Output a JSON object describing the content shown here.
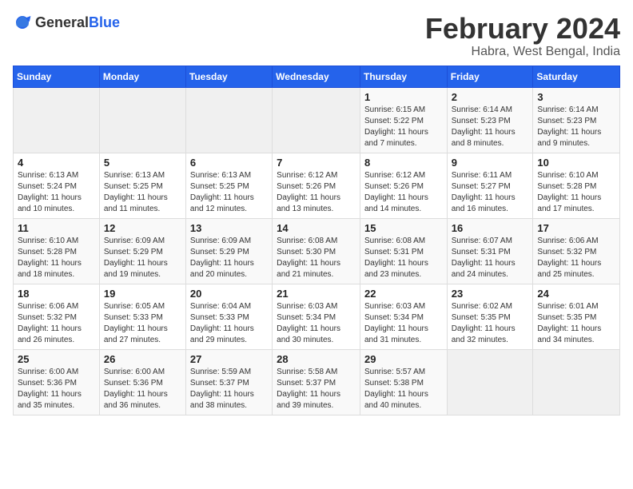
{
  "logo": {
    "general": "General",
    "blue": "Blue"
  },
  "title": {
    "month": "February 2024",
    "location": "Habra, West Bengal, India"
  },
  "headers": [
    "Sunday",
    "Monday",
    "Tuesday",
    "Wednesday",
    "Thursday",
    "Friday",
    "Saturday"
  ],
  "weeks": [
    [
      {
        "day": "",
        "info": ""
      },
      {
        "day": "",
        "info": ""
      },
      {
        "day": "",
        "info": ""
      },
      {
        "day": "",
        "info": ""
      },
      {
        "day": "1",
        "info": "Sunrise: 6:15 AM\nSunset: 5:22 PM\nDaylight: 11 hours\nand 7 minutes."
      },
      {
        "day": "2",
        "info": "Sunrise: 6:14 AM\nSunset: 5:23 PM\nDaylight: 11 hours\nand 8 minutes."
      },
      {
        "day": "3",
        "info": "Sunrise: 6:14 AM\nSunset: 5:23 PM\nDaylight: 11 hours\nand 9 minutes."
      }
    ],
    [
      {
        "day": "4",
        "info": "Sunrise: 6:13 AM\nSunset: 5:24 PM\nDaylight: 11 hours\nand 10 minutes."
      },
      {
        "day": "5",
        "info": "Sunrise: 6:13 AM\nSunset: 5:25 PM\nDaylight: 11 hours\nand 11 minutes."
      },
      {
        "day": "6",
        "info": "Sunrise: 6:13 AM\nSunset: 5:25 PM\nDaylight: 11 hours\nand 12 minutes."
      },
      {
        "day": "7",
        "info": "Sunrise: 6:12 AM\nSunset: 5:26 PM\nDaylight: 11 hours\nand 13 minutes."
      },
      {
        "day": "8",
        "info": "Sunrise: 6:12 AM\nSunset: 5:26 PM\nDaylight: 11 hours\nand 14 minutes."
      },
      {
        "day": "9",
        "info": "Sunrise: 6:11 AM\nSunset: 5:27 PM\nDaylight: 11 hours\nand 16 minutes."
      },
      {
        "day": "10",
        "info": "Sunrise: 6:10 AM\nSunset: 5:28 PM\nDaylight: 11 hours\nand 17 minutes."
      }
    ],
    [
      {
        "day": "11",
        "info": "Sunrise: 6:10 AM\nSunset: 5:28 PM\nDaylight: 11 hours\nand 18 minutes."
      },
      {
        "day": "12",
        "info": "Sunrise: 6:09 AM\nSunset: 5:29 PM\nDaylight: 11 hours\nand 19 minutes."
      },
      {
        "day": "13",
        "info": "Sunrise: 6:09 AM\nSunset: 5:29 PM\nDaylight: 11 hours\nand 20 minutes."
      },
      {
        "day": "14",
        "info": "Sunrise: 6:08 AM\nSunset: 5:30 PM\nDaylight: 11 hours\nand 21 minutes."
      },
      {
        "day": "15",
        "info": "Sunrise: 6:08 AM\nSunset: 5:31 PM\nDaylight: 11 hours\nand 23 minutes."
      },
      {
        "day": "16",
        "info": "Sunrise: 6:07 AM\nSunset: 5:31 PM\nDaylight: 11 hours\nand 24 minutes."
      },
      {
        "day": "17",
        "info": "Sunrise: 6:06 AM\nSunset: 5:32 PM\nDaylight: 11 hours\nand 25 minutes."
      }
    ],
    [
      {
        "day": "18",
        "info": "Sunrise: 6:06 AM\nSunset: 5:32 PM\nDaylight: 11 hours\nand 26 minutes."
      },
      {
        "day": "19",
        "info": "Sunrise: 6:05 AM\nSunset: 5:33 PM\nDaylight: 11 hours\nand 27 minutes."
      },
      {
        "day": "20",
        "info": "Sunrise: 6:04 AM\nSunset: 5:33 PM\nDaylight: 11 hours\nand 29 minutes."
      },
      {
        "day": "21",
        "info": "Sunrise: 6:03 AM\nSunset: 5:34 PM\nDaylight: 11 hours\nand 30 minutes."
      },
      {
        "day": "22",
        "info": "Sunrise: 6:03 AM\nSunset: 5:34 PM\nDaylight: 11 hours\nand 31 minutes."
      },
      {
        "day": "23",
        "info": "Sunrise: 6:02 AM\nSunset: 5:35 PM\nDaylight: 11 hours\nand 32 minutes."
      },
      {
        "day": "24",
        "info": "Sunrise: 6:01 AM\nSunset: 5:35 PM\nDaylight: 11 hours\nand 34 minutes."
      }
    ],
    [
      {
        "day": "25",
        "info": "Sunrise: 6:00 AM\nSunset: 5:36 PM\nDaylight: 11 hours\nand 35 minutes."
      },
      {
        "day": "26",
        "info": "Sunrise: 6:00 AM\nSunset: 5:36 PM\nDaylight: 11 hours\nand 36 minutes."
      },
      {
        "day": "27",
        "info": "Sunrise: 5:59 AM\nSunset: 5:37 PM\nDaylight: 11 hours\nand 38 minutes."
      },
      {
        "day": "28",
        "info": "Sunrise: 5:58 AM\nSunset: 5:37 PM\nDaylight: 11 hours\nand 39 minutes."
      },
      {
        "day": "29",
        "info": "Sunrise: 5:57 AM\nSunset: 5:38 PM\nDaylight: 11 hours\nand 40 minutes."
      },
      {
        "day": "",
        "info": ""
      },
      {
        "day": "",
        "info": ""
      }
    ]
  ]
}
